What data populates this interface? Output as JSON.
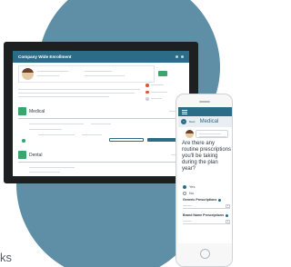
{
  "desktop": {
    "header_title": "Company Wide Enrollment",
    "plans": [
      {
        "title": "Medical"
      },
      {
        "title": "Dental"
      }
    ],
    "accent": "#2c6c86",
    "go_color": "#3aa66e"
  },
  "phone": {
    "back_label": "Back",
    "screen_title": "Medical",
    "question": "Are there any routine prescriptions you'll be taking during the plan year?",
    "options": [
      "Yes",
      "No"
    ],
    "selected_option": "Yes",
    "sections": [
      "Generic Prescriptions",
      "Brand Name Prescriptions"
    ]
  },
  "caption_fragment": "ks",
  "background_color": "#5f8fa6"
}
